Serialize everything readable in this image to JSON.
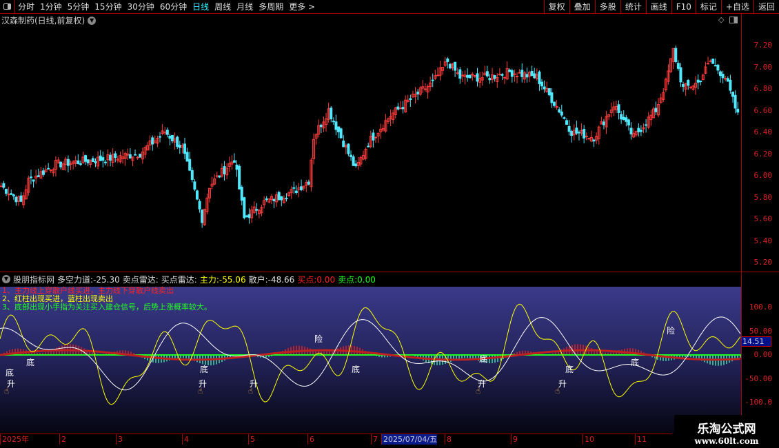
{
  "toolbar": {
    "periods": [
      "分时",
      "1分钟",
      "5分钟",
      "15分钟",
      "30分钟",
      "60分钟",
      "日线",
      "周线",
      "月线",
      "多周期",
      "更多 >"
    ],
    "active": "日线",
    "buttons": [
      "复权",
      "叠加",
      "多股",
      "统计",
      "画线",
      "F10",
      "标记",
      "+自选",
      "返回"
    ]
  },
  "stock_title": "汉森制药(日线,前复权)",
  "price_axis": [
    "7.20",
    "7.00",
    "6.80",
    "6.60",
    "6.40",
    "6.20",
    "6.00",
    "5.80",
    "5.60",
    "5.40",
    "5.20"
  ],
  "indicator": {
    "name": "股朋指标网",
    "items": [
      {
        "label": "多空力道:",
        "value": "-25.30",
        "color": "#dddddd"
      },
      {
        "label": "卖点雷达:",
        "value": "",
        "color": "#dddddd"
      },
      {
        "label": "买点雷达:",
        "value": "",
        "color": "#dddddd"
      },
      {
        "label": "主力:",
        "value": "-55.06",
        "color": "#ffff00"
      },
      {
        "label": "散户:",
        "value": "-48.66",
        "color": "#dddddd"
      },
      {
        "label": "买点:",
        "value": "0.00",
        "color": "#ff2020"
      },
      {
        "label": "卖点:",
        "value": "0.00",
        "color": "#20ff20"
      }
    ],
    "notes": [
      "1、主力线上穿散户线买进，主力线下穿散户线卖出",
      "2、红柱出现买进，蓝柱出现卖出",
      "3、底部出现小手指为关注买入建仓信号，后势上涨概率较大。"
    ],
    "axis": [
      "100.0",
      "50.00",
      "0.00",
      "-50.00",
      "-100.0"
    ],
    "current_value": "14.51",
    "markers": {
      "bottom": "底",
      "rise": "升",
      "risk": "险"
    }
  },
  "dates": [
    "2025年",
    "2",
    "3",
    "4",
    "5",
    "6",
    "7",
    "2025/07/04/五",
    "8",
    "9",
    "10",
    "11"
  ],
  "watermark": {
    "name": "乐淘公式网",
    "url": "www.60lt.com"
  },
  "chart_data": {
    "type": "candlestick",
    "title": "汉森制药(日线,前复权)",
    "ylim": [
      5.1,
      7.4
    ],
    "close_anchors": [
      [
        0,
        5.9
      ],
      [
        8,
        5.75
      ],
      [
        11,
        5.95
      ],
      [
        22,
        6.1
      ],
      [
        42,
        6.15
      ],
      [
        56,
        6.2
      ],
      [
        66,
        6.4
      ],
      [
        73,
        6.25
      ],
      [
        78,
        5.85
      ],
      [
        81,
        5.6
      ],
      [
        84,
        5.9
      ],
      [
        94,
        6.15
      ],
      [
        98,
        5.6
      ],
      [
        106,
        5.75
      ],
      [
        118,
        5.85
      ],
      [
        124,
        5.95
      ],
      [
        126,
        6.35
      ],
      [
        132,
        6.6
      ],
      [
        138,
        6.3
      ],
      [
        143,
        6.05
      ],
      [
        148,
        6.3
      ],
      [
        157,
        6.55
      ],
      [
        168,
        6.75
      ],
      [
        174,
        6.85
      ],
      [
        180,
        7.05
      ],
      [
        185,
        6.9
      ],
      [
        196,
        6.9
      ],
      [
        205,
        6.95
      ],
      [
        216,
        6.9
      ],
      [
        225,
        6.6
      ],
      [
        230,
        6.4
      ],
      [
        239,
        6.35
      ],
      [
        247,
        6.65
      ],
      [
        255,
        6.35
      ],
      [
        264,
        6.6
      ],
      [
        268,
        6.85
      ],
      [
        271,
        7.15
      ],
      [
        275,
        6.8
      ],
      [
        281,
        6.85
      ],
      [
        286,
        7.05
      ],
      [
        292,
        6.9
      ],
      [
        297,
        6.55
      ]
    ]
  }
}
